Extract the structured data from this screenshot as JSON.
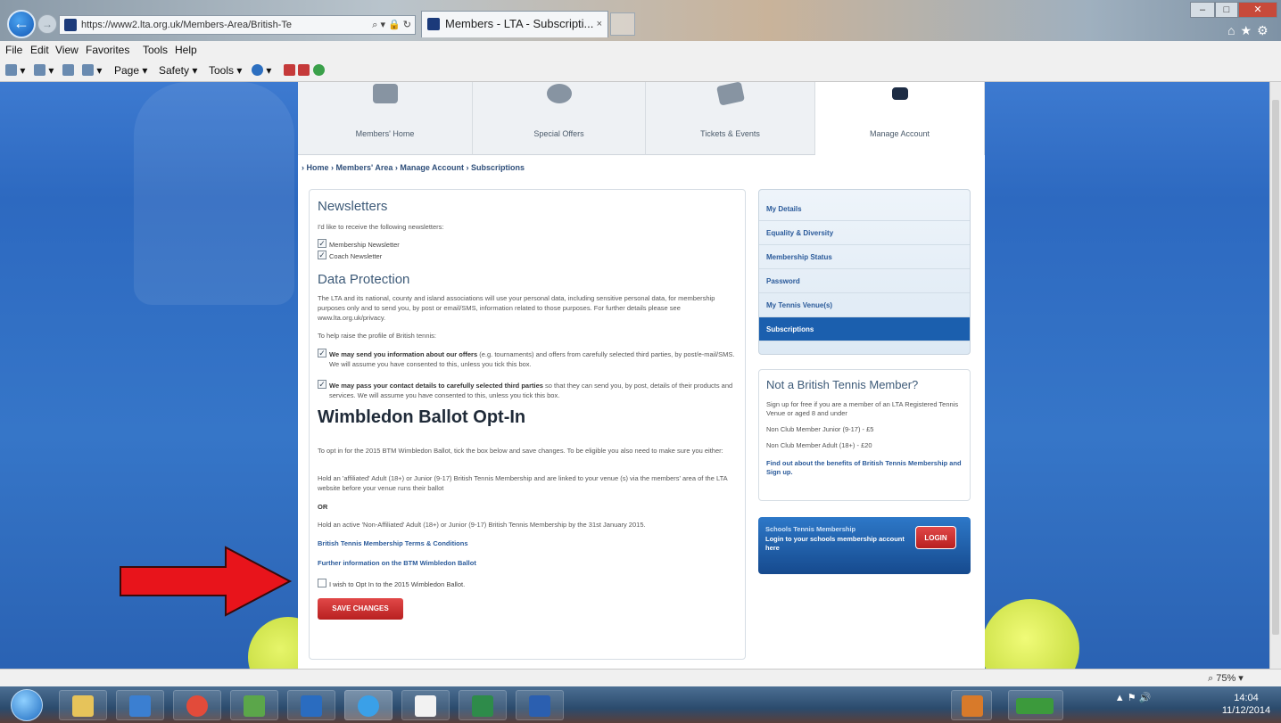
{
  "browser": {
    "url": "https://www2.lta.org.uk/Members-Area/British-Te",
    "url_controls": "⌕ ▾ 🔒 ↻",
    "tab_title": "Members - LTA - Subscripti...",
    "tab_close": "×",
    "menu": [
      "File",
      "Edit",
      "View",
      "Favorites",
      "Tools",
      "Help"
    ],
    "commands": [
      "Page ▾",
      "Safety ▾",
      "Tools ▾"
    ],
    "zoom": "75%"
  },
  "site": {
    "nav_tiles": [
      "Members' Home",
      "Special Offers",
      "Tickets & Events",
      "Manage Account"
    ],
    "breadcrumb": "› Home  › Members' Area  › Manage Account  › Subscriptions"
  },
  "content": {
    "newsletters": {
      "heading": "Newsletters",
      "intro": "I'd like to receive the following newsletters:",
      "items": [
        "Membership Newsletter",
        "Coach Newsletter"
      ]
    },
    "data_protection": {
      "heading": "Data Protection",
      "para1": "The LTA and its national, county and island associations will use your personal data, including sensitive personal data, for membership purposes only and to send you, by post or email/SMS, information related to those purposes. For further details please see www.lta.org.uk/privacy.",
      "para2": "To help raise the profile of British tennis:",
      "consent1_bold": "We may send you information about our offers",
      "consent1_rest": " (e.g. tournaments) and offers from carefully selected third parties, by post/e-mail/SMS. We will assume you have consented to this, unless you tick this box.",
      "consent2_bold": "We may pass your contact details to carefully selected third parties",
      "consent2_rest": " so that they can send you, by post, details of their products and services. We will assume you have consented to this, unless you tick this box."
    },
    "ballot": {
      "heading": "Wimbledon Ballot Opt-In",
      "para1": "To opt in for the 2015 BTM Wimbledon Ballot, tick the box below and save changes. To be eligible you also need to make sure you either:",
      "para2": "Hold an 'affiliated' Adult (18+) or Junior (9-17) British Tennis Membership and are linked to your venue (s) via the members' area of the LTA website before your venue runs their ballot",
      "or": "OR",
      "para3": "Hold an active 'Non-Affiliated' Adult (18+) or Junior (9-17) British Tennis Membership by the 31st January 2015.",
      "link1": "British Tennis Membership Terms & Conditions",
      "link2": "Further information on the BTM Wimbledon Ballot",
      "optin_label": "I wish to Opt In to the 2015 Wimbledon Ballot.",
      "save_label": "SAVE CHANGES"
    }
  },
  "sidebar": {
    "items": [
      "My Details",
      "Equality & Diversity",
      "Membership Status",
      "Password",
      "My Tennis Venue(s)",
      "Subscriptions"
    ],
    "active_index": 5
  },
  "member_box": {
    "title": "Not a British Tennis Member?",
    "text1": "Sign up for free if you are a member of an LTA Registered Tennis Venue or aged 8 and under",
    "junior": "Non Club Member Junior (9-17) - £5",
    "adult": "Non Club Member Adult (18+) - £20",
    "link": "Find out about the benefits of British Tennis Membership and Sign up."
  },
  "schools_box": {
    "title": "Schools Tennis Membership",
    "desc": "Login to your schools membership account here",
    "login": "LOGIN"
  },
  "taskbar": {
    "clock_time": "14:04",
    "clock_date": "11/12/2014"
  },
  "colors": {
    "annotation_arrow": "#e8141b",
    "accent_blue": "#1b5fae",
    "button_red": "#c82b2b"
  }
}
